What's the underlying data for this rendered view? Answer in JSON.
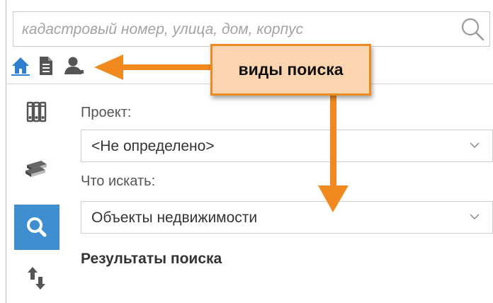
{
  "search": {
    "placeholder": "кадастровый номер, улица, дом, корпус",
    "button_icon": "search-icon"
  },
  "search_types": [
    {
      "icon": "home-icon",
      "color": "#2d7fd0"
    },
    {
      "icon": "document-icon",
      "color": "#555555"
    },
    {
      "icon": "person-icon",
      "color": "#555555"
    }
  ],
  "sidebar": {
    "items": [
      {
        "icon": "binders-icon",
        "active": false
      },
      {
        "icon": "books-icon",
        "active": false
      },
      {
        "icon": "search-icon",
        "active": true
      },
      {
        "icon": "swap-arrows-icon",
        "active": false
      }
    ],
    "active_color": "#3f8fd0"
  },
  "form": {
    "project_label": "Проект:",
    "project_value": "<Не определено>",
    "what_label": "Что искать:",
    "what_value": "Объекты недвижимости",
    "results_title": "Результаты поиска"
  },
  "annotation": {
    "callout_text": "виды поиска",
    "accent_color": "#f08a1f",
    "fill_color": "#fbd4b0"
  }
}
